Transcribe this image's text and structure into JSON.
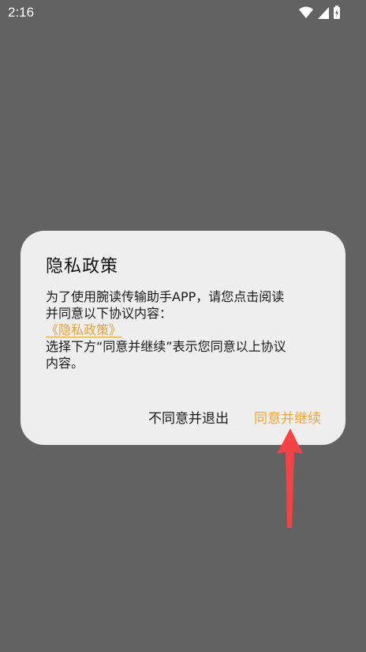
{
  "status_bar": {
    "time": "2:16",
    "icons": [
      "wifi-icon",
      "cell-signal-icon",
      "battery-icon"
    ]
  },
  "dialog": {
    "title": "隐私政策",
    "body_line1": "为了使用腕读传输助手APP，请您点击阅读",
    "body_line2": "并同意以下协议内容：",
    "policy_link": "《隐私政策》",
    "body_line3": "选择下方“同意并继续”表示您同意以上协议",
    "body_line4": "内容。",
    "decline_label": "不同意并退出",
    "accept_label": "同意并继续"
  },
  "colors": {
    "overlay": "#626262",
    "dialog_bg": "#eeeeee",
    "accent": "#f0a437",
    "annotation_arrow": "#f24447"
  }
}
